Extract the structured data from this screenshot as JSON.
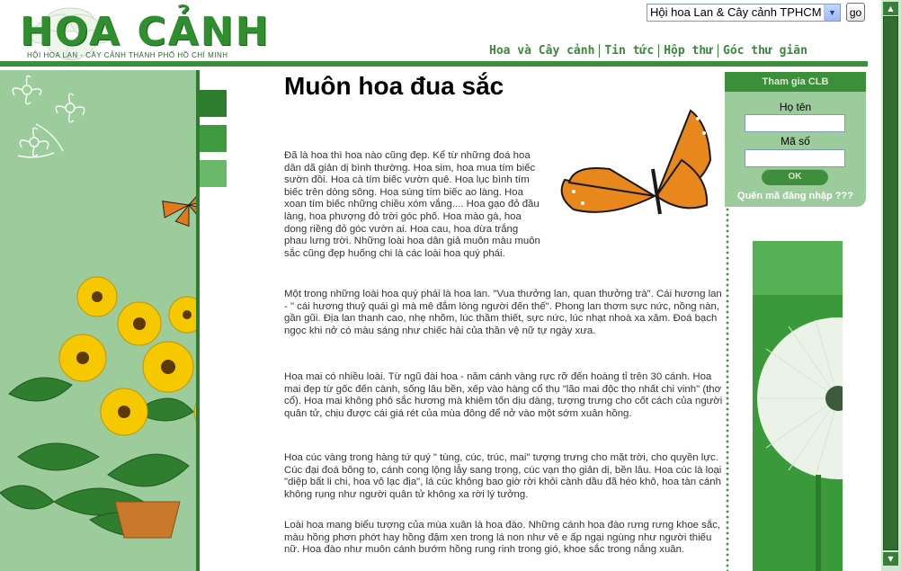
{
  "header": {
    "logo_text": "HOA CẢNH",
    "logo_subtitle": "HỘI HOA LAN - CÂY CẢNH THÀNH PHỐ HỒ CHÍ MINH",
    "site_select_value": "Hội hoa Lan & Cây cảnh TPHCM",
    "go_label": "go",
    "nav": [
      "Hoa và Cây cảnh",
      "Tin tức",
      "Hộp thư",
      "Góc thư giãn"
    ]
  },
  "article": {
    "title": "Muôn hoa đua sắc",
    "paragraphs": [
      "Đã là hoa thì hoa nào cũng đẹp. Kể từ những đoá hoa dân dã giản dị bình thường. Hoa sim, hoa mua tím biếc sườn đồi. Hoa cà tím biếc vườn quê. Hoa lục bình tím biếc trên dòng sông. Hoa súng tím biếc ao làng. Hoa xoan tím biếc những chiều xóm vắng.... Hoa gạo đỏ đầu làng, hoa phượng đỏ trời góc phố. Hoa mào gà, hoa dong riềng đỏ góc vườn ai. Hoa cau, hoa dừa trắng phau lưng trời. Những loài hoa dân giả muôn màu muôn sắc cũng đẹp huống chi là các loài hoa quý phái.",
      "Một trong những loài hoa quý phái là hoa lan. \"Vua thưởng lan, quan thưởng trà\". Cái hương lan - \" cái hương thuỷ quái gì mà mê đắm lòng người đến thế\". Phong lan thơm sực nức, nồng nàn, gần gũi. Địa lan thanh cao, nhẹ nhõm, lúc thầm thiết, sực nức, lúc nhạt nhoà xa xăm. Đoá bạch ngọc khi nở có màu sáng như chiếc hài của thần vệ nữ tự ngày xưa.",
      "Hoa mai có nhiều loài. Từ ngũ đài hoa - năm cánh vàng rực rỡ đến hoàng tỉ trên 30 cánh. Hoa mai đẹp từ gốc đến cành, sống lâu bền, xếp vào hàng cổ thụ \"lão mai độc thọ nhất chi vinh\" (thơ cổ). Hoa mai không phô sắc hương mà khiêm tốn dịu dàng, tượng trưng cho cốt cách của người quân tử, chịu được cái giá rét của mùa đông để nở vào một sớm xuân hồng.",
      "Hoa cúc vàng trong hàng tứ quý \" tùng, cúc, trúc, mai\" tượng trưng cho mặt trời, cho quyền lực. Cúc đại đoá bông to, cánh cong lộng lẫy sang trọng, cúc vạn thọ giản dị, bền lâu. Hoa cúc là loại \"diệp bất li chi, hoa vô lạc địa\", lá cúc không bao giờ rời khỏi cành dầu đã héo khô, hoa tàn cánh không rụng như người quân tử không xa rời lý tưởng.",
      "Loài hoa mang biểu tượng của mùa xuân là hoa đào. Những cánh hoa đào rưng rưng khoe sắc, màu hồng phơn phớt hay hồng đậm xen trong lá non như vẻ e ấp ngại ngùng như người thiếu nữ. Hoa đào như muôn cánh bướm hồng rung rinh trong gió, khoe sắc trong nắng xuân."
    ]
  },
  "login": {
    "header": "Tham gia CLB",
    "name_label": "Họ tên",
    "code_label": "Mã số",
    "ok_label": "OK",
    "forgot_label": "Quên mã đăng nhập ???"
  },
  "colors": {
    "brand_green": "#3b8f3b",
    "light_green": "#9ccc9c",
    "dark_green": "#2e7d2e"
  }
}
